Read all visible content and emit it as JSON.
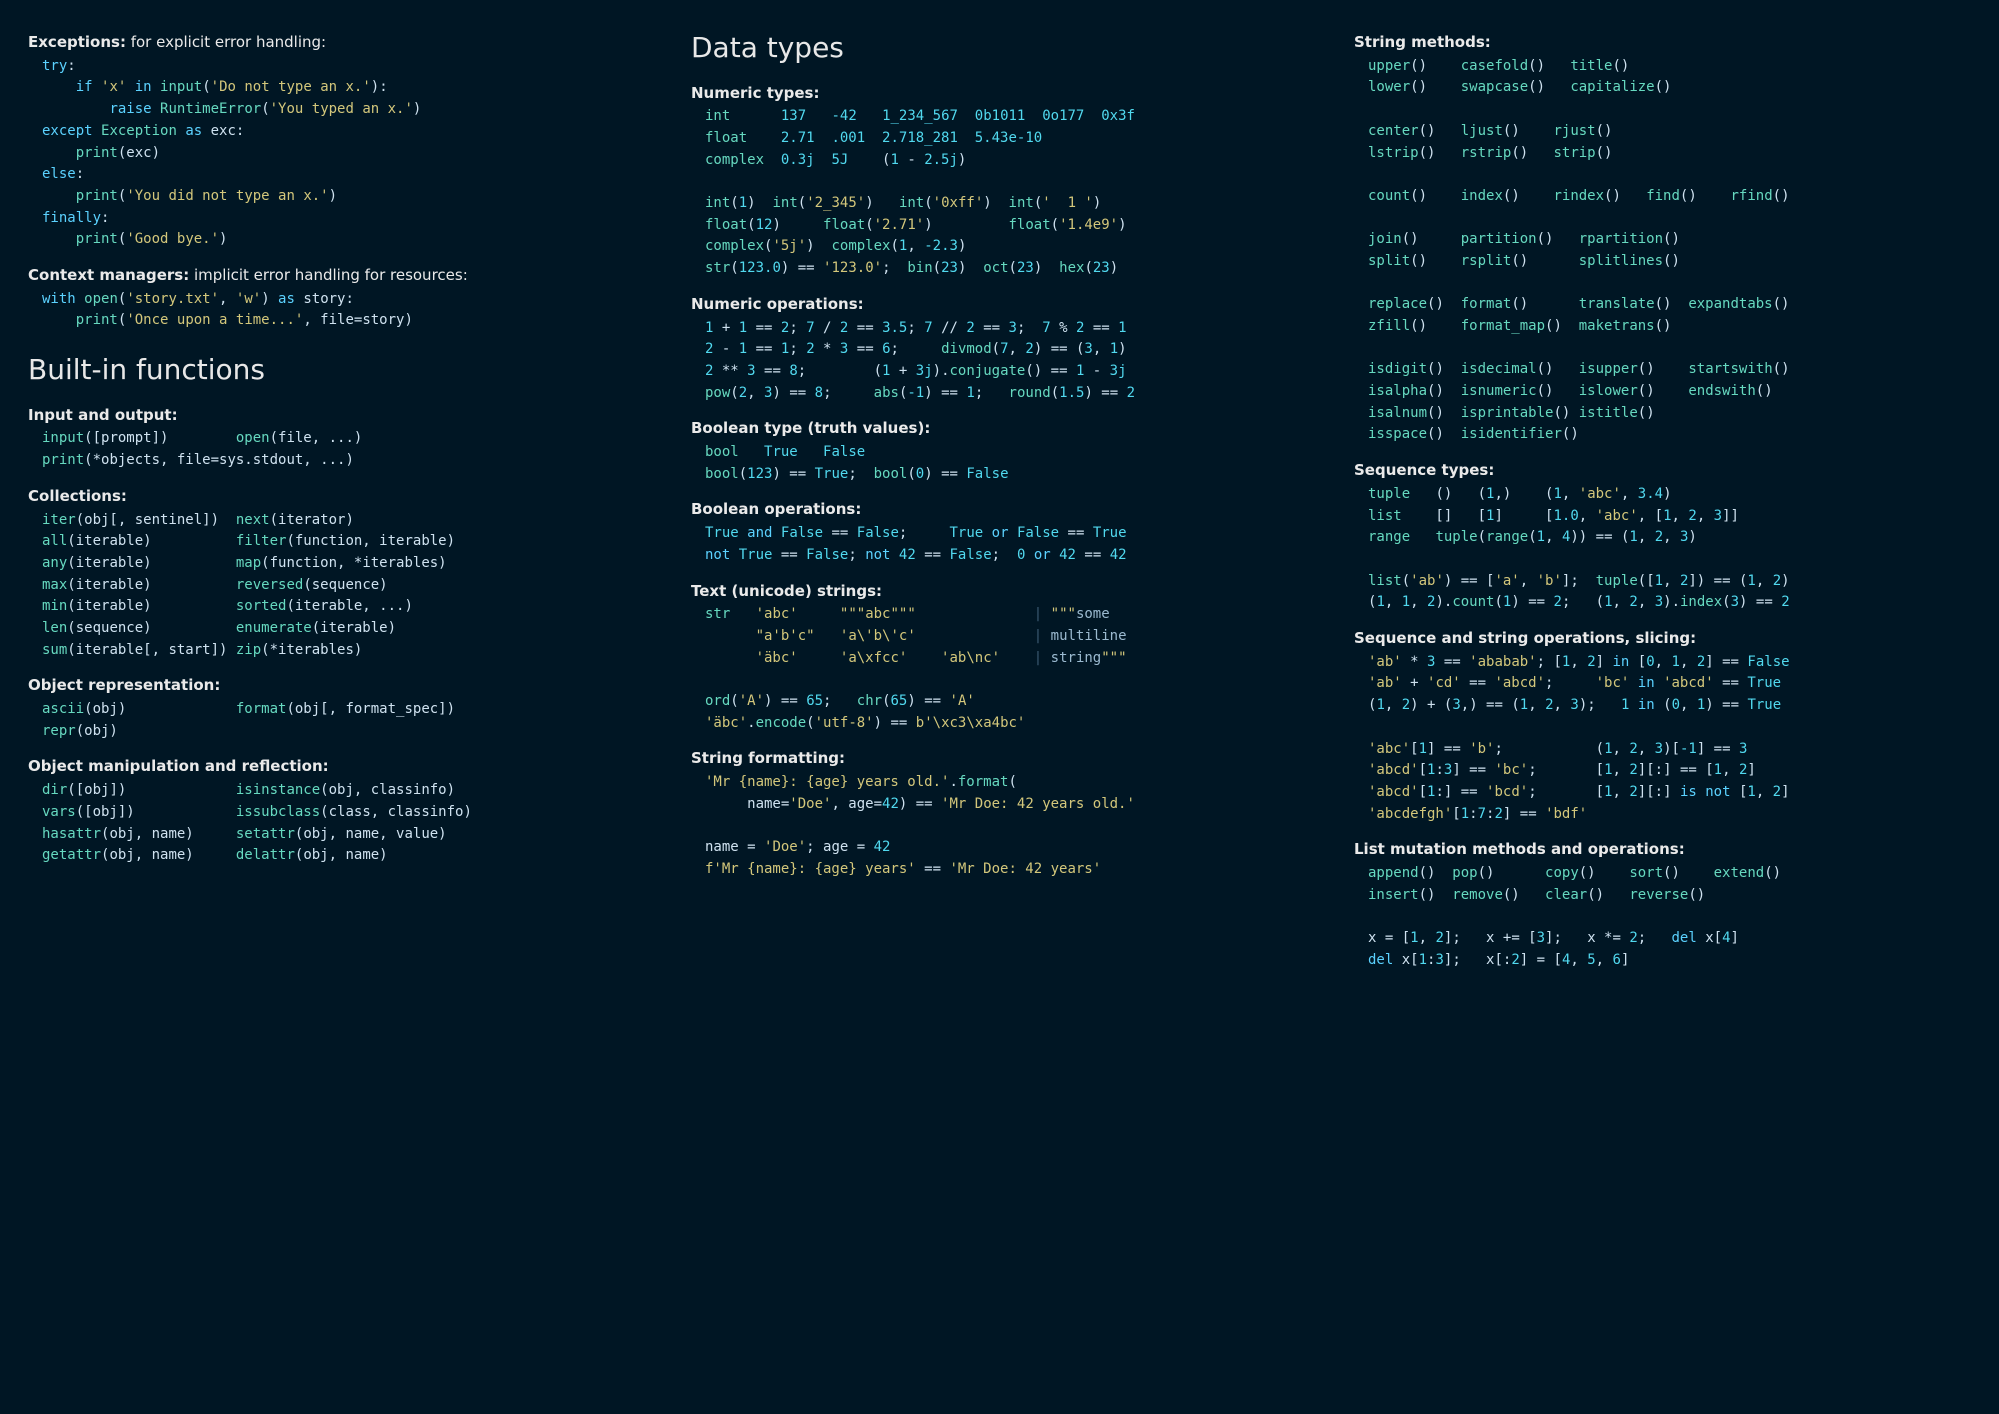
{
  "col1": {
    "exceptions_label": "Exceptions:",
    "exceptions_intro": " for explicit error handling:",
    "exceptions_code": "<span class='kw'>try</span>:\n    <span class='kw'>if</span> <span class='str'>'x'</span> <span class='kw'>in</span> <span class='fn'>input</span>(<span class='str'>'Do not type an x.'</span>):\n        <span class='kw'>raise</span> <span class='fn'>RuntimeError</span>(<span class='str'>'You typed an x.'</span>)\n<span class='kw'>except</span> <span class='fn'>Exception</span> <span class='kw'>as</span> exc:\n    <span class='fn'>print</span>(exc)\n<span class='kw'>else</span>:\n    <span class='fn'>print</span>(<span class='str'>'You did not type an x.'</span>)\n<span class='kw'>finally</span>:\n    <span class='fn'>print</span>(<span class='str'>'Good bye.'</span>)",
    "ctx_label": "Context managers:",
    "ctx_intro": " implicit error handling for resources:",
    "ctx_code": "<span class='kw'>with</span> <span class='fn'>open</span>(<span class='str'>'story.txt'</span>, <span class='str'>'w'</span>) <span class='kw'>as</span> story:\n    <span class='fn'>print</span>(<span class='str'>'Once upon a time...'</span>, file=story)",
    "h_builtins": "Built-in functions",
    "io_label": "Input and output:",
    "io_code": "<span class='fn'>input</span>([prompt])        <span class='fn'>open</span>(file, ...)\n<span class='fn'>print</span>(*objects, file=sys.stdout, ...)",
    "coll_label": "Collections:",
    "coll_code": "<span class='fn'>iter</span>(obj[, sentinel])  <span class='fn'>next</span>(iterator)\n<span class='fn'>all</span>(iterable)          <span class='fn'>filter</span>(function, iterable)\n<span class='fn'>any</span>(iterable)          <span class='fn'>map</span>(function, *iterables)\n<span class='fn'>max</span>(iterable)          <span class='fn'>reversed</span>(sequence)\n<span class='fn'>min</span>(iterable)          <span class='fn'>sorted</span>(iterable, ...)\n<span class='fn'>len</span>(sequence)          <span class='fn'>enumerate</span>(iterable)\n<span class='fn'>sum</span>(iterable[, start]) <span class='fn'>zip</span>(*iterables)",
    "repr_label": "Object representation:",
    "repr_code": "<span class='fn'>ascii</span>(obj)             <span class='fn'>format</span>(obj[, format_spec])\n<span class='fn'>repr</span>(obj)",
    "refl_label": "Object manipulation and reflection:",
    "refl_code": "<span class='fn'>dir</span>([obj])             <span class='fn'>isinstance</span>(obj, classinfo)\n<span class='fn'>vars</span>([obj])            <span class='fn'>issubclass</span>(class, classinfo)\n<span class='fn'>hasattr</span>(obj, name)     <span class='fn'>setattr</span>(obj, name, value)\n<span class='fn'>getattr</span>(obj, name)     <span class='fn'>delattr</span>(obj, name)"
  },
  "col2": {
    "h_datatypes": "Data types",
    "numtypes_label": "Numeric types:",
    "numtypes_code": "<span class='fn'>int</span>      <span class='num'>137</span>   <span class='num'>-42</span>   <span class='num'>1_234_567</span>  <span class='num'>0b1011</span>  <span class='num'>0o177</span>  <span class='num'>0x3f</span>\n<span class='fn'>float</span>    <span class='num'>2.71</span>  <span class='num'>.001</span>  <span class='num'>2.718_281</span>  <span class='num'>5.43e-10</span>\n<span class='fn'>complex</span>  <span class='num'>0.3j</span>  <span class='num'>5J</span>    (<span class='num'>1</span> - <span class='num'>2.5j</span>)\n\n<span class='fn'>int</span>(<span class='num'>1</span>)  <span class='fn'>int</span>(<span class='str'>'2_345'</span>)   <span class='fn'>int</span>(<span class='str'>'0xff'</span>)  <span class='fn'>int</span>(<span class='str'>'  1 '</span>)\n<span class='fn'>float</span>(<span class='num'>12</span>)     <span class='fn'>float</span>(<span class='str'>'2.71'</span>)         <span class='fn'>float</span>(<span class='str'>'1.4e9'</span>)\n<span class='fn'>complex</span>(<span class='str'>'5j'</span>)  <span class='fn'>complex</span>(<span class='num'>1</span>, <span class='num'>-2.3</span>)\n<span class='fn'>str</span>(<span class='num'>123.0</span>) == <span class='str'>'123.0'</span>;  <span class='fn'>bin</span>(<span class='num'>23</span>)  <span class='fn'>oct</span>(<span class='num'>23</span>)  <span class='fn'>hex</span>(<span class='num'>23</span>)",
    "numops_label": "Numeric operations:",
    "numops_code": "<span class='num'>1</span> + <span class='num'>1</span> == <span class='num'>2</span>; <span class='num'>7</span> / <span class='num'>2</span> == <span class='num'>3.5</span>; <span class='num'>7</span> // <span class='num'>2</span> == <span class='num'>3</span>;  <span class='num'>7</span> % <span class='num'>2</span> == <span class='num'>1</span>\n<span class='num'>2</span> - <span class='num'>1</span> == <span class='num'>1</span>; <span class='num'>2</span> * <span class='num'>3</span> == <span class='num'>6</span>;     <span class='fn'>divmod</span>(<span class='num'>7</span>, <span class='num'>2</span>) == (<span class='num'>3</span>, <span class='num'>1</span>)\n<span class='num'>2</span> ** <span class='num'>3</span> == <span class='num'>8</span>;        (<span class='num'>1</span> + <span class='num'>3j</span>).<span class='fn'>conjugate</span>() == <span class='num'>1</span> - <span class='num'>3j</span>\n<span class='fn'>pow</span>(<span class='num'>2</span>, <span class='num'>3</span>) == <span class='num'>8</span>;     <span class='fn'>abs</span>(<span class='num'>-1</span>) == <span class='num'>1</span>;   <span class='fn'>round</span>(<span class='num'>1.5</span>) == <span class='num'>2</span>",
    "bool_label": "Boolean type (truth values):",
    "bool_code": "<span class='fn'>bool</span>   <span class='num'>True</span>   <span class='num'>False</span>\n<span class='fn'>bool</span>(<span class='num'>123</span>) == <span class='num'>True</span>;  <span class='fn'>bool</span>(<span class='num'>0</span>) == <span class='num'>False</span>",
    "boolops_label": "Boolean operations:",
    "boolops_code": "<span class='num'>True</span> <span class='kw'>and</span> <span class='num'>False</span> == <span class='num'>False</span>;     <span class='num'>True</span> <span class='kw'>or</span> <span class='num'>False</span> == <span class='num'>True</span>\n<span class='kw'>not</span> <span class='num'>True</span> == <span class='num'>False</span>; <span class='kw'>not</span> <span class='num'>42</span> == <span class='num'>False</span>;  <span class='num'>0</span> <span class='kw'>or</span> <span class='num'>42</span> == <span class='num'>42</span>",
    "text_label": "Text (unicode) strings:",
    "text_code": "<span class='fn'>str</span>   <span class='str'>'abc'</span>     <span class='str'>\"\"\"abc\"\"\"</span>              <span class='sep'>|</span> <span class='str'>\"\"\"</span><span class='mut'>some</span>\n      <span class='str'>\"a'b'c\"</span>   <span class='str'>'a\\'b\\'c'</span>              <span class='sep'>|</span> <span class='mut'>multiline</span>\n      <span class='str'>'äbc'</span>     <span class='str'>'a\\xfcc'</span>    <span class='str'>'ab\\nc'</span>    <span class='sep'>|</span> <span class='mut'>string</span><span class='str'>\"\"\"</span>\n\n<span class='fn'>ord</span>(<span class='str'>'A'</span>) == <span class='num'>65</span>;   <span class='fn'>chr</span>(<span class='num'>65</span>) == <span class='str'>'A'</span>\n<span class='str'>'äbc'</span>.<span class='fn'>encode</span>(<span class='str'>'utf-8'</span>) == <span class='str'>b'\\xc3\\xa4bc'</span>",
    "fmt_label": "String formatting:",
    "fmt_code": "<span class='str'>'Mr {name}: {age} years old.'</span>.<span class='fn'>format</span>(\n     name=<span class='str'>'Doe'</span>, age=<span class='num'>42</span>) == <span class='str'>'Mr Doe: 42 years old.'</span>\n\nname = <span class='str'>'Doe'</span>; age = <span class='num'>42</span>\n<span class='str'>f'Mr {name}: {age} years'</span> == <span class='str'>'Mr Doe: 42 years'</span>"
  },
  "col3": {
    "strm_label": "String methods:",
    "strm_code": "<span class='fn'>upper</span>()    <span class='fn'>casefold</span>()   <span class='fn'>title</span>()\n<span class='fn'>lower</span>()    <span class='fn'>swapcase</span>()   <span class='fn'>capitalize</span>()\n\n<span class='fn'>center</span>()   <span class='fn'>ljust</span>()    <span class='fn'>rjust</span>()\n<span class='fn'>lstrip</span>()   <span class='fn'>rstrip</span>()   <span class='fn'>strip</span>()\n\n<span class='fn'>count</span>()    <span class='fn'>index</span>()    <span class='fn'>rindex</span>()   <span class='fn'>find</span>()    <span class='fn'>rfind</span>()\n\n<span class='fn'>join</span>()     <span class='fn'>partition</span>()   <span class='fn'>rpartition</span>()\n<span class='fn'>split</span>()    <span class='fn'>rsplit</span>()      <span class='fn'>splitlines</span>()\n\n<span class='fn'>replace</span>()  <span class='fn'>format</span>()      <span class='fn'>translate</span>()  <span class='fn'>expandtabs</span>()\n<span class='fn'>zfill</span>()    <span class='fn'>format_map</span>()  <span class='fn'>maketrans</span>()\n\n<span class='fn'>isdigit</span>()  <span class='fn'>isdecimal</span>()   <span class='fn'>isupper</span>()    <span class='fn'>startswith</span>()\n<span class='fn'>isalpha</span>()  <span class='fn'>isnumeric</span>()   <span class='fn'>islower</span>()    <span class='fn'>endswith</span>()\n<span class='fn'>isalnum</span>()  <span class='fn'>isprintable</span>() <span class='fn'>istitle</span>()\n<span class='fn'>isspace</span>()  <span class='fn'>isidentifier</span>()",
    "seq_label": "Sequence types:",
    "seq_code": "<span class='fn'>tuple</span>   ()   (<span class='num'>1</span>,)    (<span class='num'>1</span>, <span class='str'>'abc'</span>, <span class='num'>3.4</span>)\n<span class='fn'>list</span>    []   [<span class='num'>1</span>]     [<span class='num'>1.0</span>, <span class='str'>'abc'</span>, [<span class='num'>1</span>, <span class='num'>2</span>, <span class='num'>3</span>]]\n<span class='fn'>range</span>   <span class='fn'>tuple</span>(<span class='fn'>range</span>(<span class='num'>1</span>, <span class='num'>4</span>)) == (<span class='num'>1</span>, <span class='num'>2</span>, <span class='num'>3</span>)\n\n<span class='fn'>list</span>(<span class='str'>'ab'</span>) == [<span class='str'>'a'</span>, <span class='str'>'b'</span>];  <span class='fn'>tuple</span>([<span class='num'>1</span>, <span class='num'>2</span>]) == (<span class='num'>1</span>, <span class='num'>2</span>)\n(<span class='num'>1</span>, <span class='num'>1</span>, <span class='num'>2</span>).<span class='fn'>count</span>(<span class='num'>1</span>) == <span class='num'>2</span>;   (<span class='num'>1</span>, <span class='num'>2</span>, <span class='num'>3</span>).<span class='fn'>index</span>(<span class='num'>3</span>) == <span class='num'>2</span>",
    "slice_label": "Sequence and string operations, slicing:",
    "slice_code": "<span class='str'>'ab'</span> * <span class='num'>3</span> == <span class='str'>'ababab'</span>; [<span class='num'>1</span>, <span class='num'>2</span>] <span class='kw'>in</span> [<span class='num'>0</span>, <span class='num'>1</span>, <span class='num'>2</span>] == <span class='num'>False</span>\n<span class='str'>'ab'</span> + <span class='str'>'cd'</span> == <span class='str'>'abcd'</span>;     <span class='str'>'bc'</span> <span class='kw'>in</span> <span class='str'>'abcd'</span> == <span class='num'>True</span>\n(<span class='num'>1</span>, <span class='num'>2</span>) + (<span class='num'>3</span>,) == (<span class='num'>1</span>, <span class='num'>2</span>, <span class='num'>3</span>);   <span class='num'>1</span> <span class='kw'>in</span> (<span class='num'>0</span>, <span class='num'>1</span>) == <span class='num'>True</span>\n\n<span class='str'>'abc'</span>[<span class='num'>1</span>] == <span class='str'>'b'</span>;           (<span class='num'>1</span>, <span class='num'>2</span>, <span class='num'>3</span>)[<span class='num'>-1</span>] == <span class='num'>3</span>\n<span class='str'>'abcd'</span>[<span class='num'>1</span>:<span class='num'>3</span>] == <span class='str'>'bc'</span>;       [<span class='num'>1</span>, <span class='num'>2</span>][:] == [<span class='num'>1</span>, <span class='num'>2</span>]\n<span class='str'>'abcd'</span>[<span class='num'>1</span>:] == <span class='str'>'bcd'</span>;       [<span class='num'>1</span>, <span class='num'>2</span>][:] <span class='kw'>is not</span> [<span class='num'>1</span>, <span class='num'>2</span>]\n<span class='str'>'abcdefgh'</span>[<span class='num'>1</span>:<span class='num'>7</span>:<span class='num'>2</span>] == <span class='str'>'bdf'</span>",
    "mut_label": "List mutation methods and operations:",
    "mut_code": "<span class='fn'>append</span>()  <span class='fn'>pop</span>()      <span class='fn'>copy</span>()    <span class='fn'>sort</span>()    <span class='fn'>extend</span>()\n<span class='fn'>insert</span>()  <span class='fn'>remove</span>()   <span class='fn'>clear</span>()   <span class='fn'>reverse</span>()\n\nx = [<span class='num'>1</span>, <span class='num'>2</span>];   x += [<span class='num'>3</span>];   x *= <span class='num'>2</span>;   <span class='kw'>del</span> x[<span class='num'>4</span>]\n<span class='kw'>del</span> x[<span class='num'>1</span>:<span class='num'>3</span>];   x[:<span class='num'>2</span>] = [<span class='num'>4</span>, <span class='num'>5</span>, <span class='num'>6</span>]"
  }
}
